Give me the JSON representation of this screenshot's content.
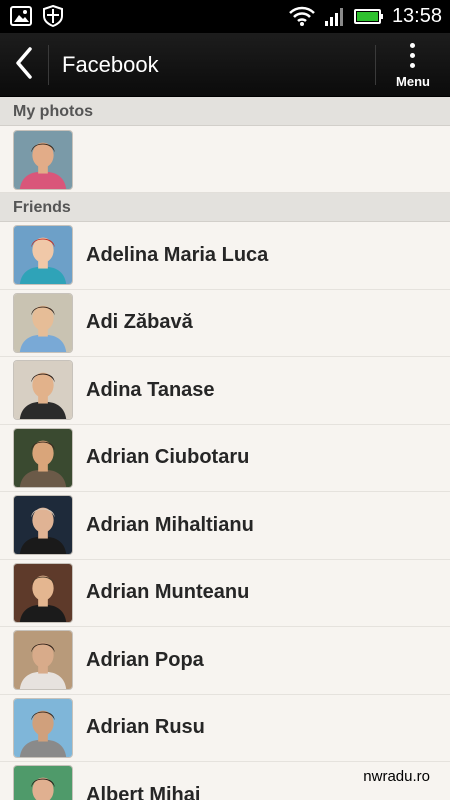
{
  "status_bar": {
    "time": "13:58",
    "left_icons": [
      "gallery-icon",
      "shield-icon"
    ],
    "right_icons": [
      "wifi-icon",
      "signal-icon",
      "battery-icon"
    ]
  },
  "action_bar": {
    "title": "Facebook",
    "menu_label": "Menu"
  },
  "sections": {
    "my_photos": {
      "header": "My photos"
    },
    "friends": {
      "header": "Friends"
    }
  },
  "friends": [
    {
      "name": "Adelina Maria Luca",
      "avatar_bg": "#6da0c8",
      "skin": "#f0c8a8",
      "hair": "#c0342a",
      "shirt": "#2fa3b8"
    },
    {
      "name": "Adi Zăbavă",
      "avatar_bg": "#c9c3b2",
      "skin": "#e6bd97",
      "hair": "#3b2a20",
      "shirt": "#79a9d6"
    },
    {
      "name": "Adina Tanase",
      "avatar_bg": "#d7cfc3",
      "skin": "#e2b28b",
      "hair": "#2a1d17",
      "shirt": "#2b2b2b"
    },
    {
      "name": "Adrian Ciubotaru",
      "avatar_bg": "#3a4a30",
      "skin": "#d9a57a",
      "hair": "#3a2b1f",
      "shirt": "#6b5a48"
    },
    {
      "name": "Adrian Mihaltianu",
      "avatar_bg": "#1e2a3a",
      "skin": "#e0b394",
      "hair": "#d8c8b8",
      "shirt": "#1a1a1a"
    },
    {
      "name": "Adrian Munteanu",
      "avatar_bg": "#5e3a2a",
      "skin": "#e4b690",
      "hair": "#4a3a2a",
      "shirt": "#1b1b1b"
    },
    {
      "name": "Adrian Popa",
      "avatar_bg": "#b89a7a",
      "skin": "#d8ab8a",
      "hair": "#2e2018",
      "shirt": "#e7e2de"
    },
    {
      "name": "Adrian Rusu",
      "avatar_bg": "#7fb6d9",
      "skin": "#d0a07c",
      "hair": "#3a2c22",
      "shirt": "#8a8a8a"
    },
    {
      "name": "Albert Mihai",
      "avatar_bg": "#4f9a6a",
      "skin": "#e0b090",
      "hair": "#2a1f18",
      "shirt": "#2f2f2f"
    }
  ],
  "my_photo": {
    "avatar_bg": "#7a9aa8",
    "skin": "#e2ac88",
    "hair": "#3a2a1e",
    "shirt": "#d9567a"
  },
  "watermark": "nwradu.ro"
}
